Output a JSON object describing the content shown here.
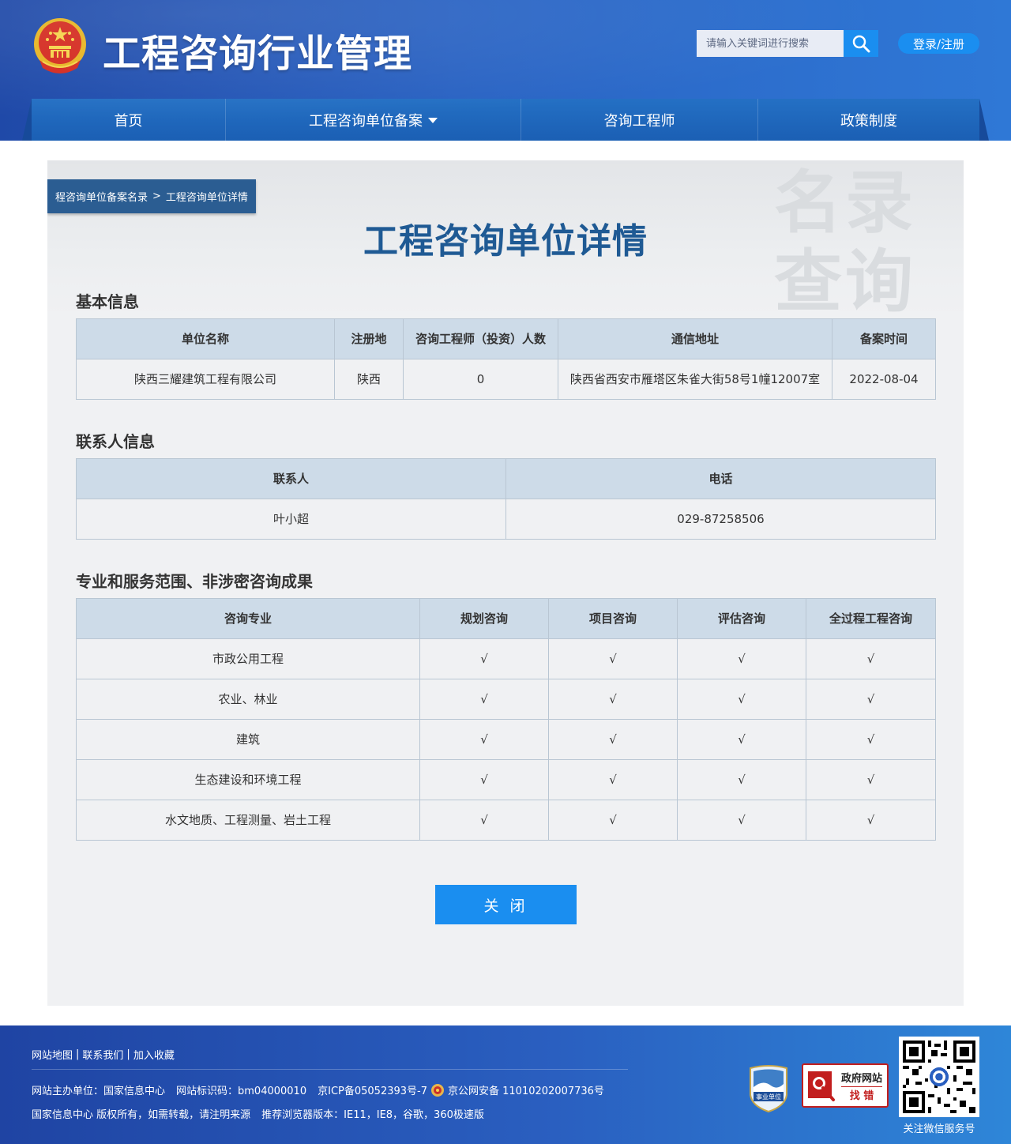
{
  "header": {
    "site_title": "工程咨询行业管理",
    "search_placeholder": "请输入关键词进行搜索",
    "login_label": "登录/注册"
  },
  "nav": {
    "items": [
      {
        "label": "首页"
      },
      {
        "label": "工程咨询单位备案"
      },
      {
        "label": "咨询工程师"
      },
      {
        "label": "政策制度"
      }
    ]
  },
  "breadcrumb": {
    "parent": "程咨询单位备案名录",
    "separator": ">",
    "current": "工程咨询单位详情"
  },
  "page": {
    "heading": "工程咨询单位详情",
    "watermark_line1": "名录",
    "watermark_line2": "查询"
  },
  "basic_info": {
    "title": "基本信息",
    "headers": [
      "单位名称",
      "注册地",
      "咨询工程师（投资）人数",
      "通信地址",
      "备案时间"
    ],
    "row": [
      "陕西三耀建筑工程有限公司",
      "陕西",
      "0",
      "陕西省西安市雁塔区朱雀大街58号1幢12007室",
      "2022-08-04"
    ]
  },
  "contact_info": {
    "title": "联系人信息",
    "headers": [
      "联系人",
      "电话"
    ],
    "row": [
      "叶小超",
      "029-87258506"
    ]
  },
  "scope": {
    "title": "专业和服务范围、非涉密咨询成果",
    "headers": [
      "咨询专业",
      "规划咨询",
      "项目咨询",
      "评估咨询",
      "全过程工程咨询"
    ],
    "rows": [
      [
        "市政公用工程",
        "√",
        "√",
        "√",
        "√"
      ],
      [
        "农业、林业",
        "√",
        "√",
        "√",
        "√"
      ],
      [
        "建筑",
        "√",
        "√",
        "√",
        "√"
      ],
      [
        "生态建设和环境工程",
        "√",
        "√",
        "√",
        "√"
      ],
      [
        "水文地质、工程测量、岩土工程",
        "√",
        "√",
        "√",
        "√"
      ]
    ]
  },
  "actions": {
    "close_label": "关 闭"
  },
  "footer": {
    "links": [
      "网站地图",
      "联系我们",
      "加入收藏"
    ],
    "link_separator": "|",
    "host": "网站主办单位：国家信息中心",
    "site_code": "网站标识码：bm04000010",
    "icp": "京ICP备05052393号-7",
    "police": "京公网安备 11010202007736号",
    "copyright": "国家信息中心 版权所有，如需转载，请注明来源",
    "browser": "推荐浏览器版本：IE11，IE8，谷歌，360极速版",
    "badge_label": "事业单位",
    "gov_error_line1": "政府网站",
    "gov_error_line2": "找 错",
    "qr_label": "关注微信服务号"
  },
  "colors": {
    "header_blue": "#2a5fc0",
    "nav_blue": "#1b5fb4",
    "accent_blue": "#1a8ef0",
    "heading_blue": "#1f5a94",
    "table_header": "#cddbe8",
    "table_border": "#b9c6d3"
  }
}
